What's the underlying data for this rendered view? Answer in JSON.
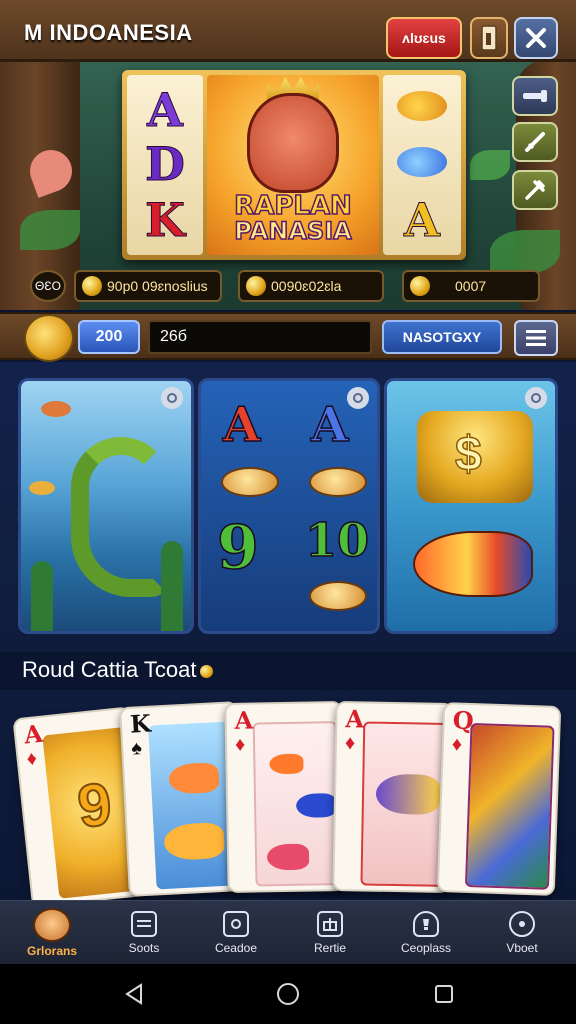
{
  "header": {
    "title": "INDOANESIA",
    "title_prefix": "M",
    "red_button_label": "ʌlʊɛus",
    "icons": [
      "door-icon",
      "close-x-icon"
    ]
  },
  "side_buttons": [
    "key-icon",
    "sword-icon",
    "tools-icon"
  ],
  "slot": {
    "reel_left": [
      "A",
      "D",
      "K"
    ],
    "reel_right_letter": "A",
    "logo_line1": "RAPLAN",
    "logo_line2": "PANASIA"
  },
  "counters": {
    "badge": "ΘƐO",
    "balance": "90р0 09ɛnoslius",
    "win": "0090ɛ02ɛla",
    "credits": "0007"
  },
  "controls": {
    "bet_label": "200",
    "lines_value": "26б",
    "spin_label": "NASOTGXY",
    "menu_icon": "menu-icon"
  },
  "game_tiles": [
    {
      "name": "Eel game",
      "symbols": []
    },
    {
      "name": "Letters game",
      "symbols": [
        "A",
        "A",
        "9",
        "10"
      ]
    },
    {
      "name": "Coins game",
      "symbols": [
        "$"
      ]
    }
  ],
  "section": {
    "title": "Roud Cattia Tcoat"
  },
  "playing_cards": [
    {
      "rank": "A",
      "suit": "♦",
      "color": "red",
      "art": "9"
    },
    {
      "rank": "K",
      "suit": "♠",
      "color": "black",
      "art": ""
    },
    {
      "rank": "A",
      "suit": "♦",
      "color": "red",
      "art": ""
    },
    {
      "rank": "A",
      "suit": "♦",
      "color": "red",
      "art": ""
    },
    {
      "rank": "Q",
      "suit": "♦",
      "color": "red",
      "art": ""
    }
  ],
  "tabbar": {
    "items": [
      {
        "label": "Grlorans",
        "icon": "avatar-icon",
        "active": true
      },
      {
        "label": "Soots",
        "icon": "list-icon",
        "active": false
      },
      {
        "label": "Ceadoe",
        "icon": "badge-icon",
        "active": false
      },
      {
        "label": "Rertie",
        "icon": "gift-icon",
        "active": false
      },
      {
        "label": "Ceoplass",
        "icon": "trophy-icon",
        "active": false
      },
      {
        "label": "Vboet",
        "icon": "settings-icon",
        "active": false
      }
    ]
  },
  "colors": {
    "accent_red": "#c62222",
    "accent_blue": "#2a55b8",
    "gold": "#f0c25a",
    "active_tab": "#ffb24a"
  }
}
